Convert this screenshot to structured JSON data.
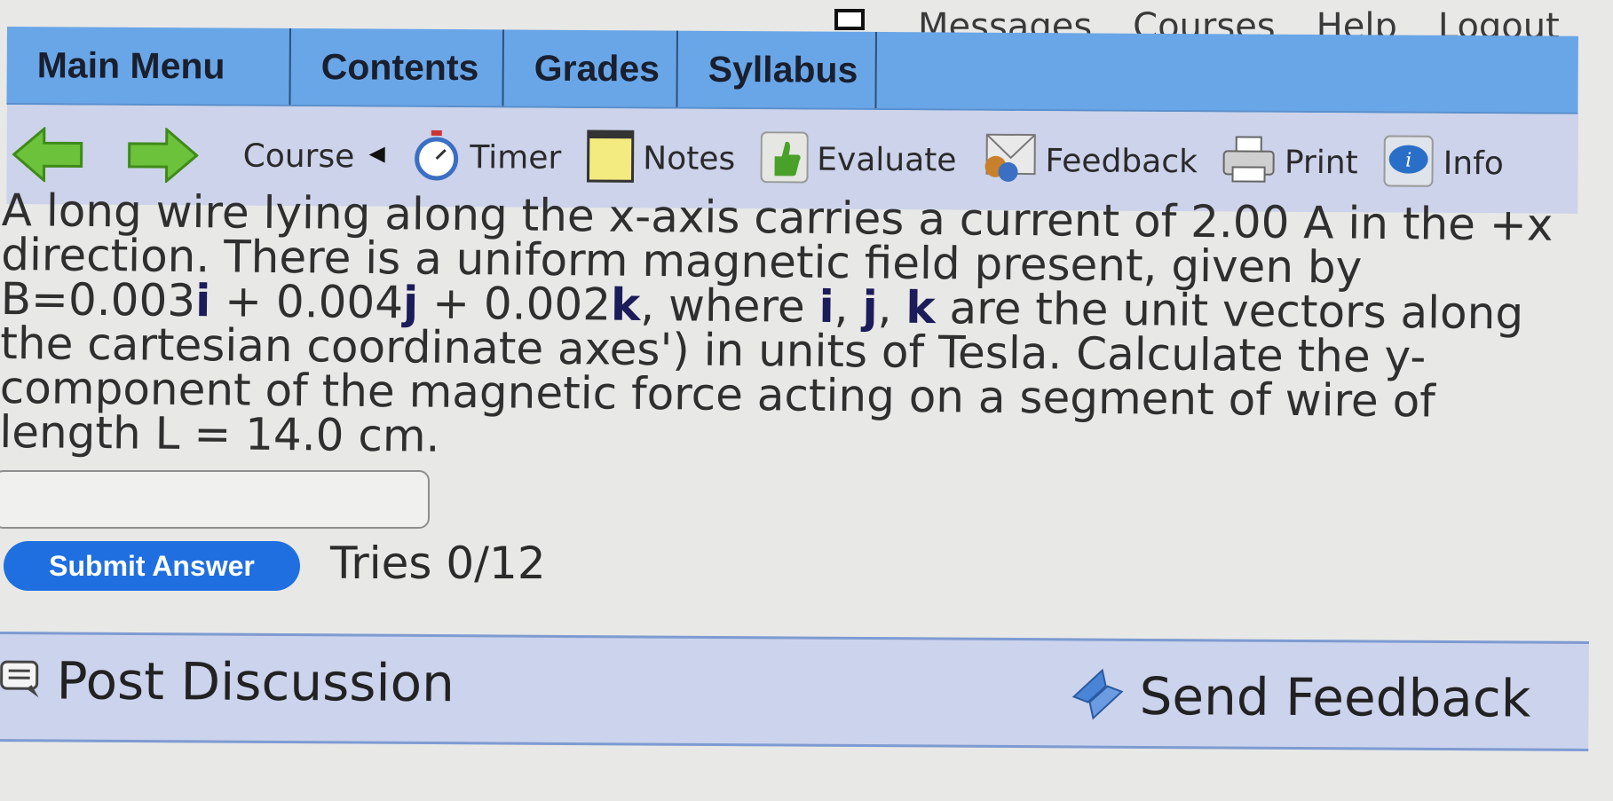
{
  "top_links": {
    "messages": "Messages",
    "courses": "Courses",
    "help": "Help",
    "logout": "Logout"
  },
  "tabs": [
    "Main Menu",
    "Contents",
    "Grades",
    "Syllabus"
  ],
  "toolbar": {
    "course": "Course",
    "timer": "Timer",
    "notes": "Notes",
    "evaluate": "Evaluate",
    "feedback": "Feedback",
    "print": "Print",
    "info": "Info"
  },
  "question": {
    "p1": "A long wire lying along the x-axis carries a current of 2.00 A in the +x direction. There is a uniform magnetic field present, given by B=0.003",
    "i1": "i",
    "p2": " + 0.004",
    "j1": "j",
    "p3": " + 0.002",
    "k1": "k",
    "p4": ", where ",
    "i2": "i",
    "c1": ", ",
    "j2": "j",
    "c2": ", ",
    "k2": "k",
    "p5": " are the unit vectors along the cartesian coordinate axes') in units of Tesla. Calculate the y-component of the magnetic force acting on a segment of wire of length L = 14.0 cm."
  },
  "answer": {
    "value": ""
  },
  "submit_label": "Submit Answer",
  "tries": "Tries 0/12",
  "bottom": {
    "post_discussion": "Post Discussion",
    "send_feedback": "Send Feedback"
  },
  "colors": {
    "tab_bar": "#69a6e8",
    "toolbar_bg": "#ccd3ea",
    "submit_button": "#1f6fe0",
    "arrow_green": "#6cc23a"
  },
  "icons": [
    "laptop-icon",
    "back-arrow-icon",
    "forward-arrow-icon",
    "triangle-left-icon",
    "stopwatch-icon",
    "notepad-icon",
    "thumbs-up-icon",
    "feedback-envelope-icon",
    "printer-icon",
    "info-bubble-icon",
    "discussion-icon",
    "send-arrows-icon"
  ]
}
